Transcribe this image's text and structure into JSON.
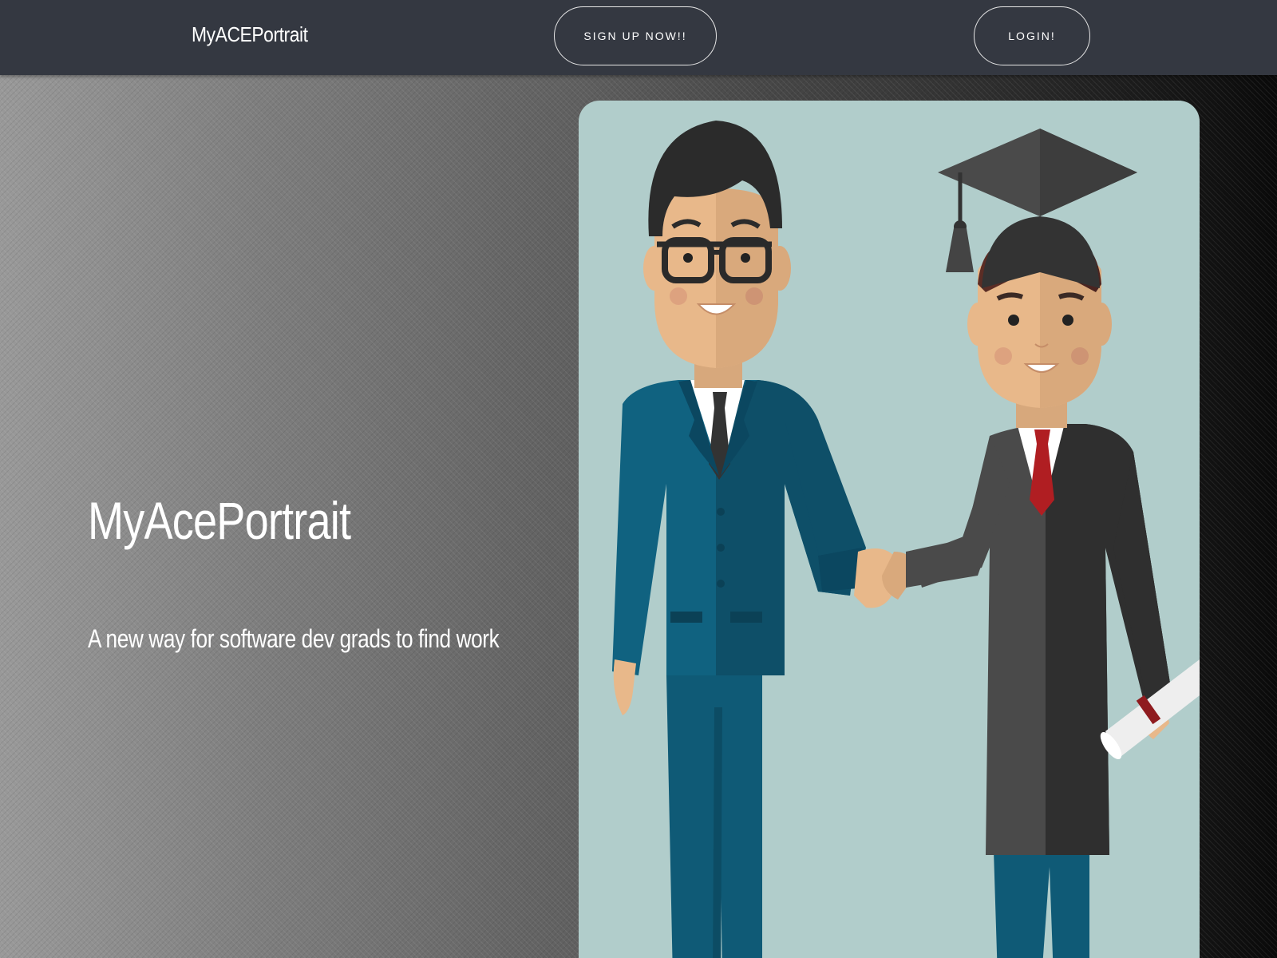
{
  "nav": {
    "brand": "MyACEPortrait",
    "signup_label": "SIGN UP NOW!!",
    "login_label": "LOGIN!"
  },
  "hero": {
    "title": "MyAcePortrait",
    "subtitle": "A new way for software dev grads to find work"
  },
  "colors": {
    "navbar": "#343841",
    "illustration_bg": "#b1cdcb",
    "suit": "#106280",
    "gown": "#3f3f3f",
    "tie_red": "#b01e22"
  },
  "illustration": {
    "description_icons": [
      "businessman-figure",
      "graduate-figure",
      "handshake",
      "graduation-cap-icon",
      "diploma-icon"
    ]
  }
}
